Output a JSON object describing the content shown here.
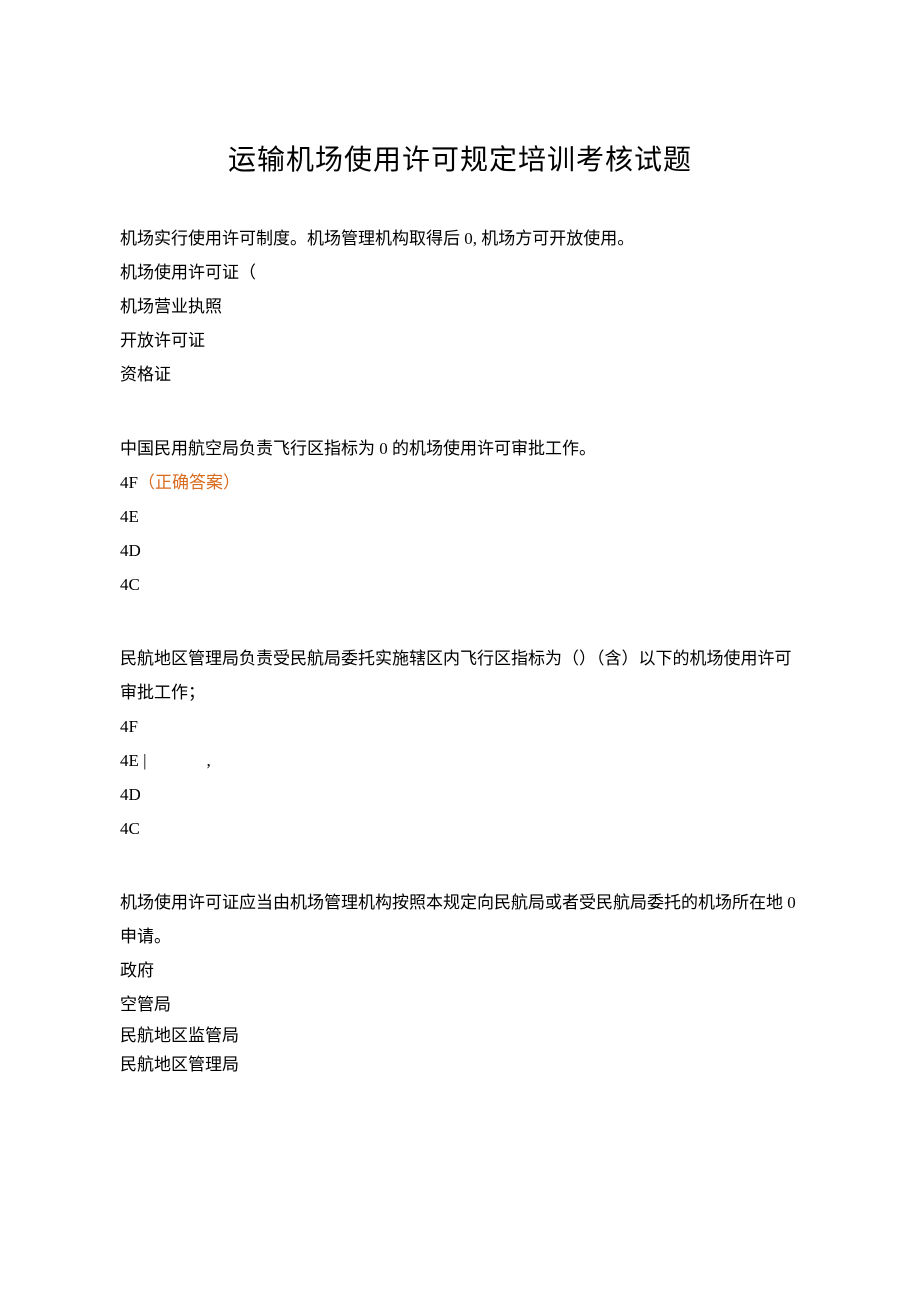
{
  "title": "运输机场使用许可规定培训考核试题",
  "q1": {
    "stem": "机场实行使用许可制度。机场管理机构取得后 0, 机场方可开放使用。",
    "a": "机场使用许可证（",
    "b": "机场营业执照",
    "c": "开放许可证",
    "d": "资格证"
  },
  "q2": {
    "stem": "中国民用航空局负责飞行区指标为 0 的机场使用许可审批工作。",
    "a_prefix": "4F",
    "a_mark": "（正确答案）",
    "b": "4E",
    "c": "4D",
    "d": "4C"
  },
  "q3": {
    "stem": "民航地区管理局负责受民航局委托实施辖区内飞行区指标为（）（含）以下的机场使用许可审批工作；",
    "a": "4F",
    "b_prefix": "4E |",
    "b_suffix": ",",
    "c": "4D",
    "d": "4C"
  },
  "q4": {
    "stem": "机场使用许可证应当由机场管理机构按照本规定向民航局或者受民航局委托的机场所在地 0 申请。",
    "a": "政府",
    "b": "空管局",
    "c": "民航地区监管局",
    "d": "民航地区管理局"
  }
}
